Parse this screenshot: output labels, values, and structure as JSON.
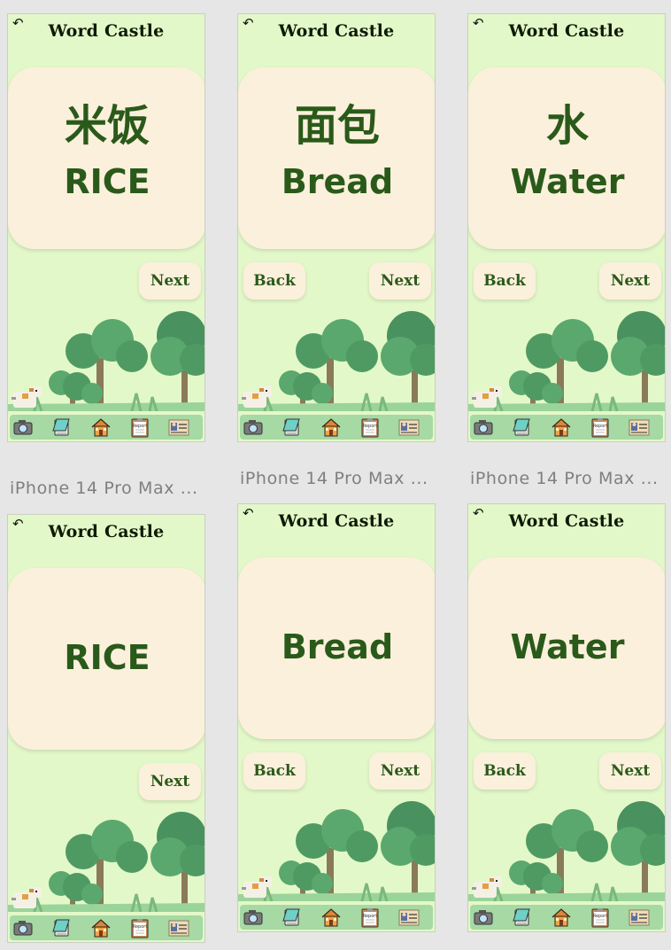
{
  "app": {
    "title": "Word Castle",
    "back_icon": "undo-arrow-icon"
  },
  "screens": [
    {
      "zh": "米饭",
      "en": "RICE",
      "back": "",
      "next": "Next"
    },
    {
      "zh": "面包",
      "en": "Bread",
      "back": "Back",
      "next": "Next"
    },
    {
      "zh": "水",
      "en": "Water",
      "back": "Back",
      "next": "Next"
    },
    {
      "zh": "",
      "en": "RICE",
      "back": "",
      "next": "Next"
    },
    {
      "zh": "",
      "en": "Bread",
      "back": "Back",
      "next": "Next"
    },
    {
      "zh": "",
      "en": "Water",
      "back": "Back",
      "next": "Next"
    }
  ],
  "frame_labels": [
    "iPhone 14 Pro Max ...",
    "iPhone 14 Pro Max ...",
    "iPhone 14 Pro Max ..."
  ],
  "nav_icons": [
    "camera-icon",
    "notebook-icon",
    "house-icon",
    "report-icon",
    "profile-card-icon"
  ],
  "nav_report_label": "Report",
  "colors": {
    "canvas": "#e6e6e6",
    "screen": "#e3f8c8",
    "card": "#fbf0dc",
    "word_text": "#2a5a1a",
    "navbar": "#a6d9a4"
  }
}
